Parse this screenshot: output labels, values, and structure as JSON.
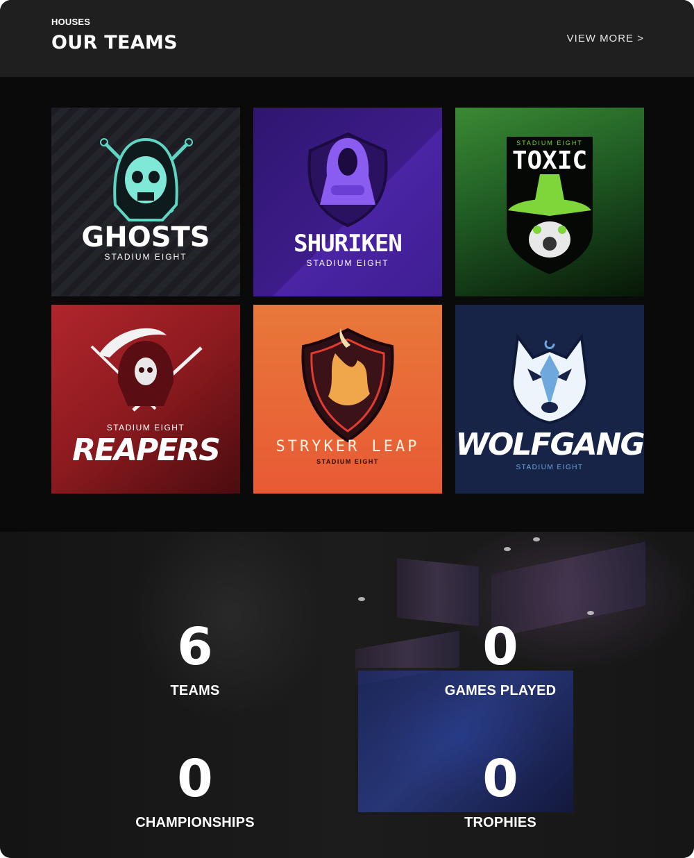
{
  "header": {
    "eyebrow": "HOUSES",
    "title": "OUR TEAMS",
    "view_more": "VIEW MORE >"
  },
  "teams": [
    {
      "name": "GHOSTS",
      "subtitle": "STADIUM EIGHT",
      "icon": "hooded-skull-crossed-swords",
      "color": "#5fd6c4"
    },
    {
      "name": "SHURIKEN",
      "subtitle": "STADIUM EIGHT",
      "icon": "hooded-ninja",
      "color": "#8a5cf0"
    },
    {
      "name": "TOXIC",
      "subtitle": "STADIUM EIGHT",
      "icon": "gas-mask-witch",
      "color": "#7ed63a"
    },
    {
      "name": "REAPERS",
      "subtitle": "STADIUM EIGHT",
      "icon": "reaper-scythe",
      "color": "#c8252b"
    },
    {
      "name": "STRYKER LEAP",
      "subtitle": "STADIUM EIGHT",
      "icon": "dragon-shield",
      "color": "#e8a23a"
    },
    {
      "name": "WOLFGANG",
      "subtitle": "STADIUM EIGHT",
      "icon": "wolf-head",
      "color": "#6fa8dc"
    }
  ],
  "stats": [
    {
      "value": "6",
      "label": "TEAMS"
    },
    {
      "value": "0",
      "label": "GAMES PLAYED"
    },
    {
      "value": "0",
      "label": "CHAMPIONSHIPS"
    },
    {
      "value": "0",
      "label": "TROPHIES"
    }
  ]
}
